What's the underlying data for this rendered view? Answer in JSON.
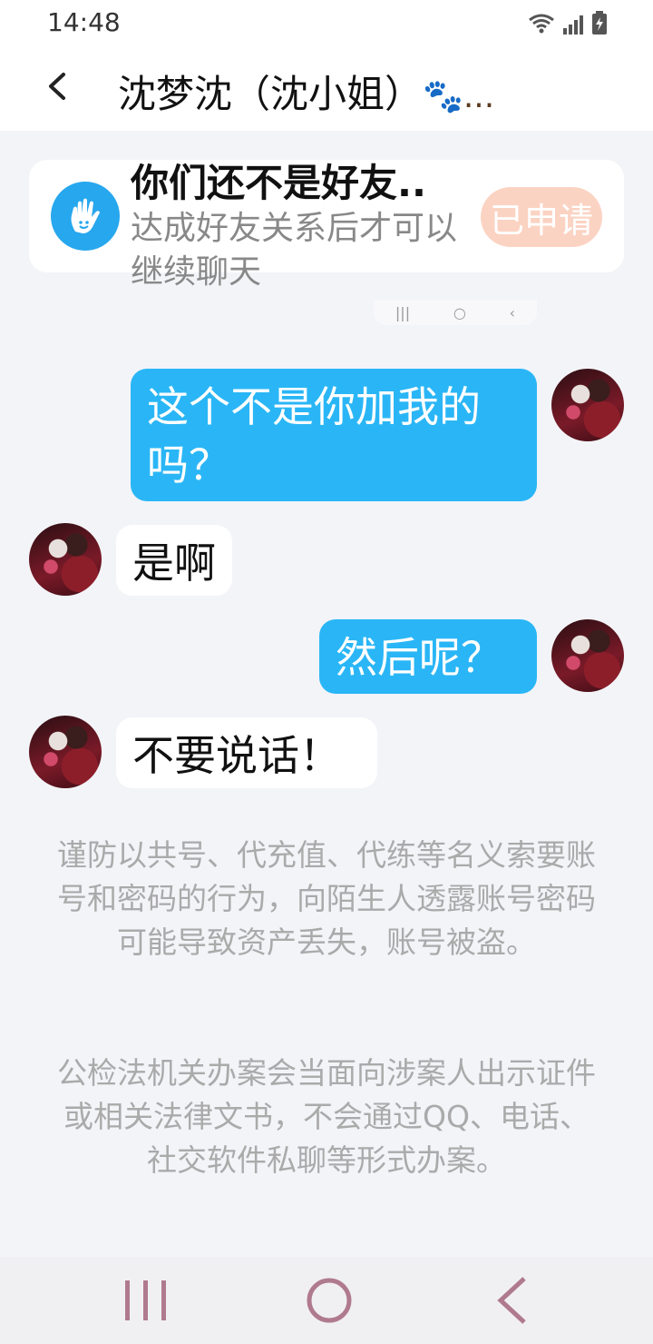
{
  "status": {
    "time": "14:48"
  },
  "header": {
    "title": "沈梦沈（沈小姐）",
    "title_suffix": "🐾..."
  },
  "friend_card": {
    "title": "你们还不是好友..",
    "subtitle": "达成好友关系后才可以继续聊天",
    "button": "已申请"
  },
  "messages": [
    {
      "side": "out",
      "text": "这个不是你加我的吗？"
    },
    {
      "side": "in",
      "text": "是啊"
    },
    {
      "side": "out",
      "text": "然后呢？"
    },
    {
      "side": "in",
      "text": "不要说话！"
    }
  ],
  "notices": [
    "谨防以共号、代充值、代练等名义索要账号和密码的行为，向陌生人透露账号密码可能导致资产丢失，账号被盗。",
    "公检法机关办案会当面向涉案人出示证件或相关法律文书，不会通过QQ、电话、社交软件私聊等形式办案。"
  ],
  "icons": {
    "back": "chevron-left-icon",
    "wave": "hand-wave-icon",
    "wifi": "wifi-icon",
    "signal": "signal-icon",
    "battery": "battery-icon"
  },
  "colors": {
    "out_bubble": "#2ab6f6",
    "apply_button": "#fbd3c3",
    "friend_icon": "#27a7ee"
  }
}
